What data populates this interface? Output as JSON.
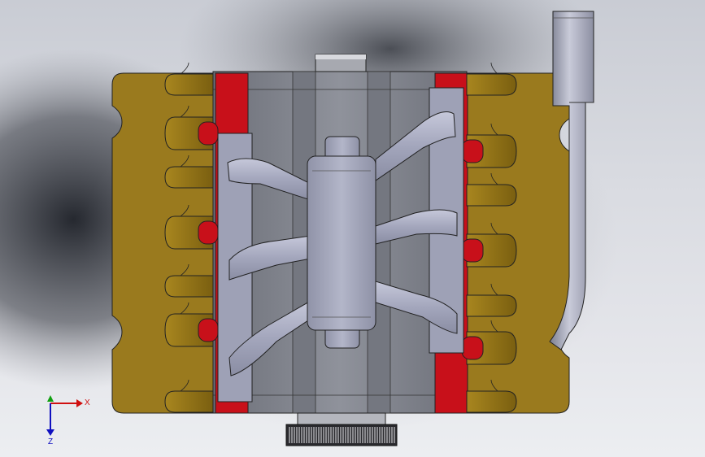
{
  "viewport": {
    "background_top": "#c9ccd4",
    "background_bottom": "#eceef1"
  },
  "model": {
    "description_icon": "v-engine-top-view",
    "colors": {
      "cylinder_head": "#9a7a1e",
      "cylinder_head_dark": "#6b5410",
      "gasket": "#c8101a",
      "block": "#8a8d96",
      "block_dark": "#5e6069",
      "intake": "#a9acc2",
      "intake_light": "#c7c9dc",
      "pulley": "#2a2a2e",
      "exhaust_pipe": "#9ea1b3"
    }
  },
  "triad": {
    "x_label": "X",
    "z_label": "Z",
    "x_color": "#d01010",
    "y_color": "#10a010",
    "z_color": "#1010c0"
  }
}
